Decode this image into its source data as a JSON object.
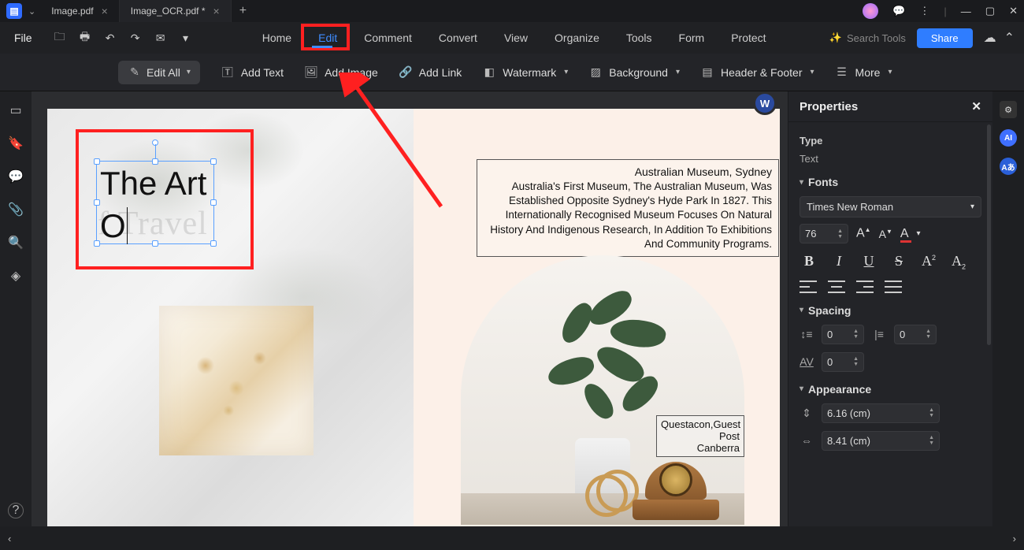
{
  "tabs": [
    {
      "label": "Image.pdf",
      "active": false
    },
    {
      "label": "Image_OCR.pdf *",
      "active": true
    }
  ],
  "menu": {
    "file": "File",
    "items": [
      "Home",
      "Edit",
      "Comment",
      "Convert",
      "View",
      "Organize",
      "Tools",
      "Form",
      "Protect"
    ],
    "active": "Edit",
    "search_placeholder": "Search Tools",
    "share": "Share"
  },
  "toolbar": {
    "edit_all": "Edit All",
    "add_text": "Add Text",
    "add_image": "Add Image",
    "add_link": "Add Link",
    "watermark": "Watermark",
    "background": "Background",
    "header_footer": "Header & Footer",
    "more": "More"
  },
  "document": {
    "text_block": {
      "line1": "The Art",
      "line2": "O",
      "faded": "f Travel"
    },
    "museum": {
      "title": "Australian Museum, Sydney",
      "body": "Australia's First Museum, The Australian Museum, Was Established Opposite Sydney's Hyde Park In 1827. This Internationally Recognised Museum Focuses On Natural History And Indigenous Research, In Addition To Exhibitions And Community Programs."
    },
    "canberra": {
      "line1": "Questacon,Guest Post",
      "line2": "Canberra"
    }
  },
  "properties": {
    "title": "Properties",
    "type_label": "Type",
    "type_value": "Text",
    "fonts": {
      "title": "Fonts",
      "family": "Times New Roman",
      "size": "76"
    },
    "spacing": {
      "title": "Spacing",
      "line": "0",
      "para": "0",
      "char": "0"
    },
    "appearance": {
      "title": "Appearance",
      "height": "6.16 (cm)",
      "width": "8.41 (cm)"
    }
  }
}
